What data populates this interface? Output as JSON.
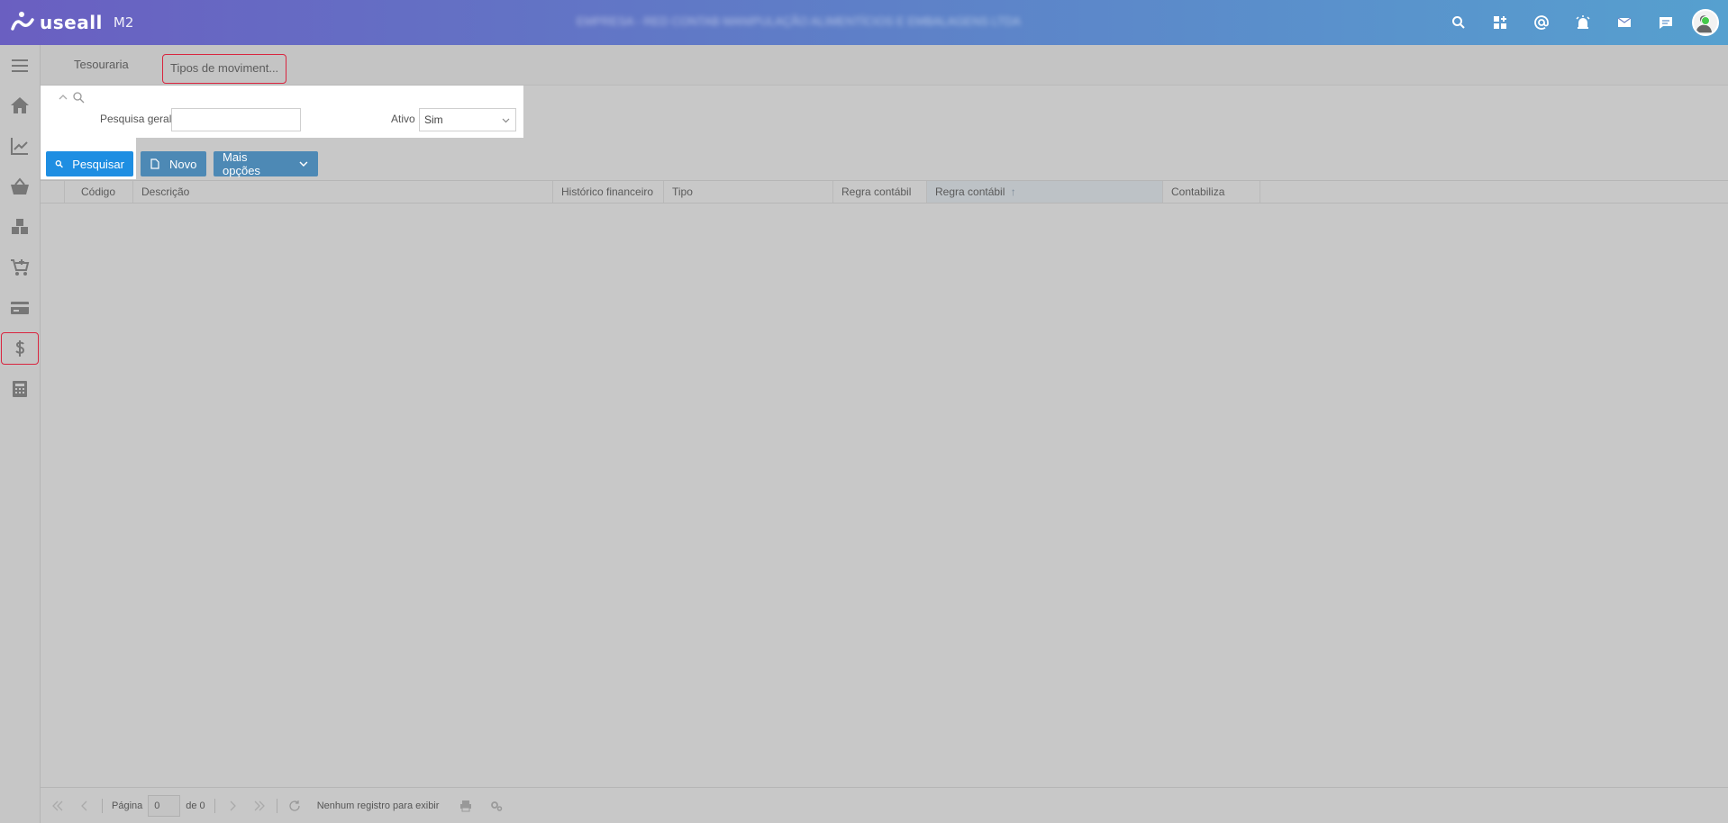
{
  "app": {
    "logo_text": "useall",
    "logo_version": "M2",
    "company_name": "EMPRESA - RED CONTAB MANIPULAÇÃO ALIMENTÍCIOS E EMBALAGENS LTDA"
  },
  "topbar": {
    "icons": [
      "search-icon",
      "grid-add-icon",
      "at-icon",
      "alarm-icon",
      "mail-icon",
      "chat-icon"
    ]
  },
  "sidebar": {
    "items": [
      "menu-icon",
      "home-icon",
      "chart-icon",
      "basket-icon",
      "boxes-icon",
      "cart-add-icon",
      "card-icon",
      "dollar-icon",
      "calculator-icon"
    ],
    "active": "dollar-icon",
    "active_color": "#d9253f"
  },
  "tabs": [
    {
      "label": "Tesouraria"
    },
    {
      "label": "Tipos de moviment..."
    }
  ],
  "filter": {
    "general_search_label": "Pesquisa geral",
    "general_search_value": "",
    "active_label": "Ativo",
    "active_value": "Sim"
  },
  "toolbar": {
    "search_label": "Pesquisar",
    "new_label": "Novo",
    "more_label": "Mais opções",
    "primary_color": "#1e8ee2",
    "secondary_color": "#4d89b5"
  },
  "grid": {
    "columns": [
      "Código",
      "Descrição",
      "Histórico financeiro",
      "Tipo",
      "Regra contábil",
      "Regra contábil",
      "Contabiliza"
    ],
    "sorted_column": "Regra contábil",
    "rows": []
  },
  "pagination": {
    "page_label": "Página",
    "page_value": "0",
    "of_label": "de 0",
    "status": "Nenhum registro para exibir"
  }
}
